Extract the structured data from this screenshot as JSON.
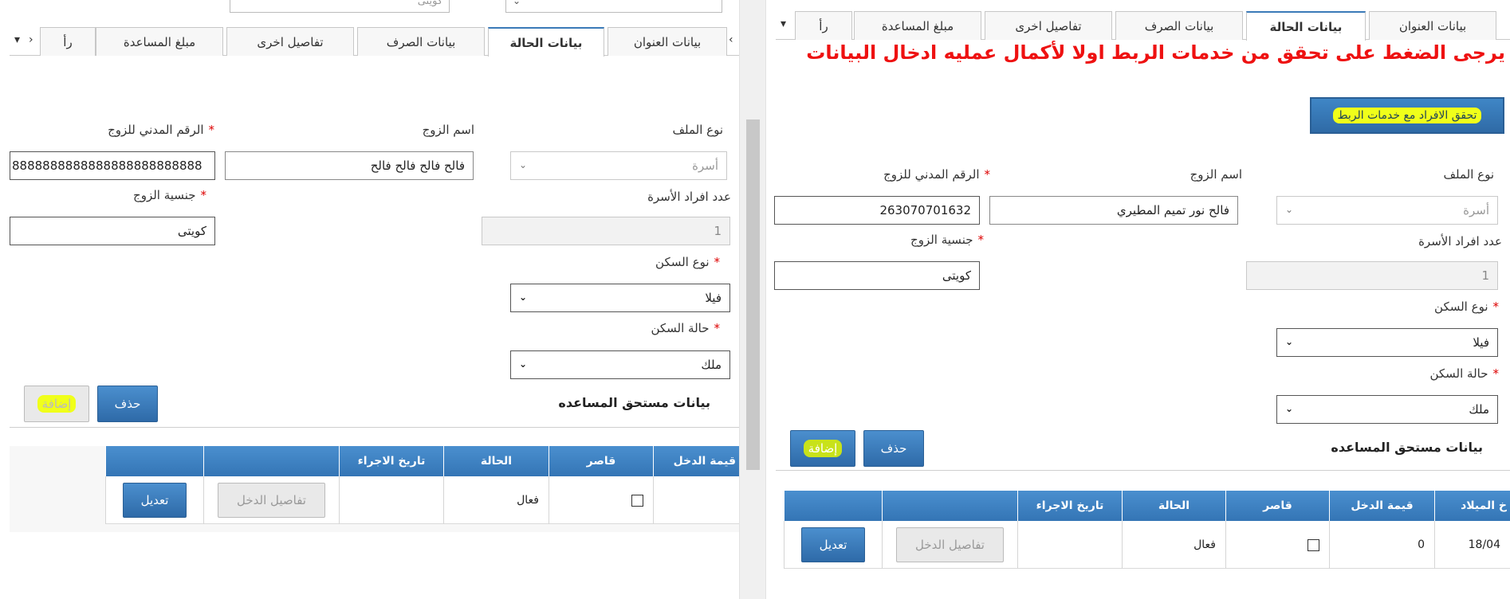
{
  "left": {
    "top_stubs": [
      "",
      "كويتى"
    ],
    "tabs": [
      "بيانات العنوان",
      "بيانات الحالة",
      "بيانات الصرف",
      "تفاصيل اخرى",
      "مبلغ المساعدة",
      "رأ"
    ],
    "fields": {
      "file_type_label": "نوع الملف",
      "file_type_value": "أسرة",
      "spouse_name_label": "اسم الزوج",
      "spouse_name_value": "فالح فالح فالح فالح",
      "spouse_civil_label": "الرقم المدني للزوج",
      "spouse_civil_value": "8888888888888888888888888",
      "family_count_label": "عدد افراد الأسرة",
      "family_count_value": "1",
      "spouse_nationality_label": "جنسية الزوج",
      "spouse_nationality_value": "كويتى",
      "housing_type_label": "نوع السكن",
      "housing_type_value": "فيلا",
      "housing_status_label": "حالة السكن",
      "housing_status_value": "ملك"
    },
    "buttons": {
      "add": "إضافة",
      "delete": "حذف"
    },
    "section_title": "بيانات مستحق المساعده",
    "table": {
      "headers": [
        "قيمة الدخل",
        "قاصر",
        "الحالة",
        "تاريخ الاجراء",
        "",
        ""
      ],
      "row": {
        "status": "فعال",
        "income_details": "تفاصيل الدخل",
        "edit": "تعديل"
      }
    }
  },
  "right": {
    "tabs": [
      "بيانات العنوان",
      "بيانات الحالة",
      "بيانات الصرف",
      "تفاصيل اخرى",
      "مبلغ المساعدة",
      "رأ"
    ],
    "banner": "يرجى الضغط على تحقق من خدمات الربط اولا لأكمال عمليه ادخال البيانات",
    "verify_button": "تحقق الافراد مع خدمات الربط",
    "fields": {
      "file_type_label": "نوع الملف",
      "file_type_value": "أسرة",
      "spouse_name_label": "اسم الزوج",
      "spouse_name_value": "فالح نور تميم المطيري",
      "spouse_civil_label": "الرقم المدني للزوج",
      "spouse_civil_value": "263070701632",
      "family_count_label": "عدد افراد الأسرة",
      "family_count_value": "1",
      "spouse_nationality_label": "جنسية الزوج",
      "spouse_nationality_value": "كويتى",
      "housing_type_label": "نوع السكن",
      "housing_type_value": "فيلا",
      "housing_status_label": "حالة السكن",
      "housing_status_value": "ملك"
    },
    "buttons": {
      "add": "إضافة",
      "delete": "حذف"
    },
    "section_title": "بيانات مستحق المساعده",
    "table": {
      "headers": [
        "خ الميلاد",
        "قيمة الدخل",
        "قاصر",
        "الحالة",
        "تاريخ الاجراء",
        "",
        ""
      ],
      "row": {
        "birth": "18/04",
        "income": "0",
        "status": "فعال",
        "income_details": "تفاصيل الدخل",
        "edit": "تعديل"
      }
    }
  },
  "icons": {
    "tab_left": "chevron-left-icon",
    "tab_right": "chevron-right-icon",
    "tab_menu": "caret-down-icon",
    "select": "chevron-down-icon"
  },
  "colors": {
    "accent": "#3a7ab8",
    "banner": "#ee1111",
    "highlight": "#f0ff1a"
  }
}
